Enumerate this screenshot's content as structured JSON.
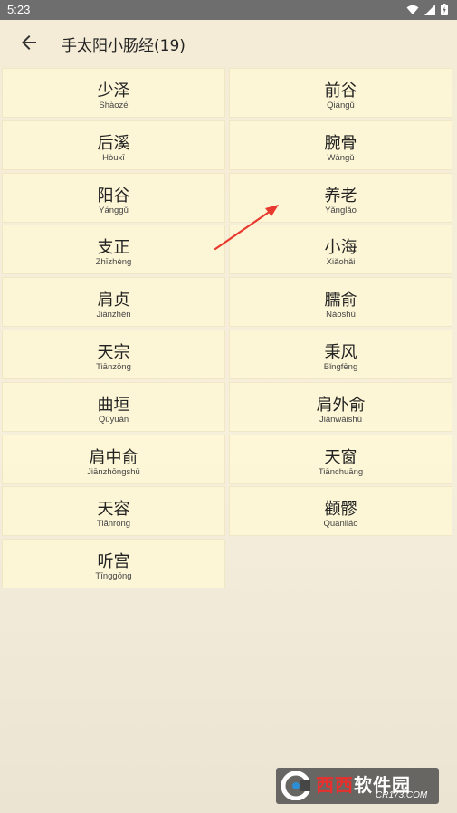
{
  "status_bar": {
    "time": "5:23"
  },
  "header": {
    "title": "手太阳小肠经(19)"
  },
  "points": [
    {
      "name": "少泽",
      "pinyin": "Shàozé"
    },
    {
      "name": "前谷",
      "pinyin": "Qiángǔ"
    },
    {
      "name": "后溪",
      "pinyin": "Hòuxī"
    },
    {
      "name": "腕骨",
      "pinyin": "Wàngǔ"
    },
    {
      "name": "阳谷",
      "pinyin": "Yánggǔ"
    },
    {
      "name": "养老",
      "pinyin": "Yǎnglǎo"
    },
    {
      "name": "支正",
      "pinyin": "Zhīzhèng"
    },
    {
      "name": "小海",
      "pinyin": "Xiǎohǎi"
    },
    {
      "name": "肩贞",
      "pinyin": "Jiānzhēn"
    },
    {
      "name": "臑俞",
      "pinyin": "Nàoshū"
    },
    {
      "name": "天宗",
      "pinyin": "Tiānzōng"
    },
    {
      "name": "秉风",
      "pinyin": "Bǐngfēng"
    },
    {
      "name": "曲垣",
      "pinyin": "Qūyuán"
    },
    {
      "name": "肩外俞",
      "pinyin": "Jiānwàishū"
    },
    {
      "name": "肩中俞",
      "pinyin": "Jiānzhōngshū"
    },
    {
      "name": "天窗",
      "pinyin": "Tiānchuāng"
    },
    {
      "name": "天容",
      "pinyin": "Tiānróng"
    },
    {
      "name": "颧髎",
      "pinyin": "Quánliáo"
    },
    {
      "name": "听宫",
      "pinyin": "Tīnggōng"
    }
  ],
  "watermark": {
    "brand_part1": "西西",
    "brand_part2": "软件园",
    "site": "CR173.COM"
  },
  "colors": {
    "cell_bg": "#fdf6d6",
    "arrow": "#e8392e",
    "status_bar": "#6e6e6e"
  }
}
